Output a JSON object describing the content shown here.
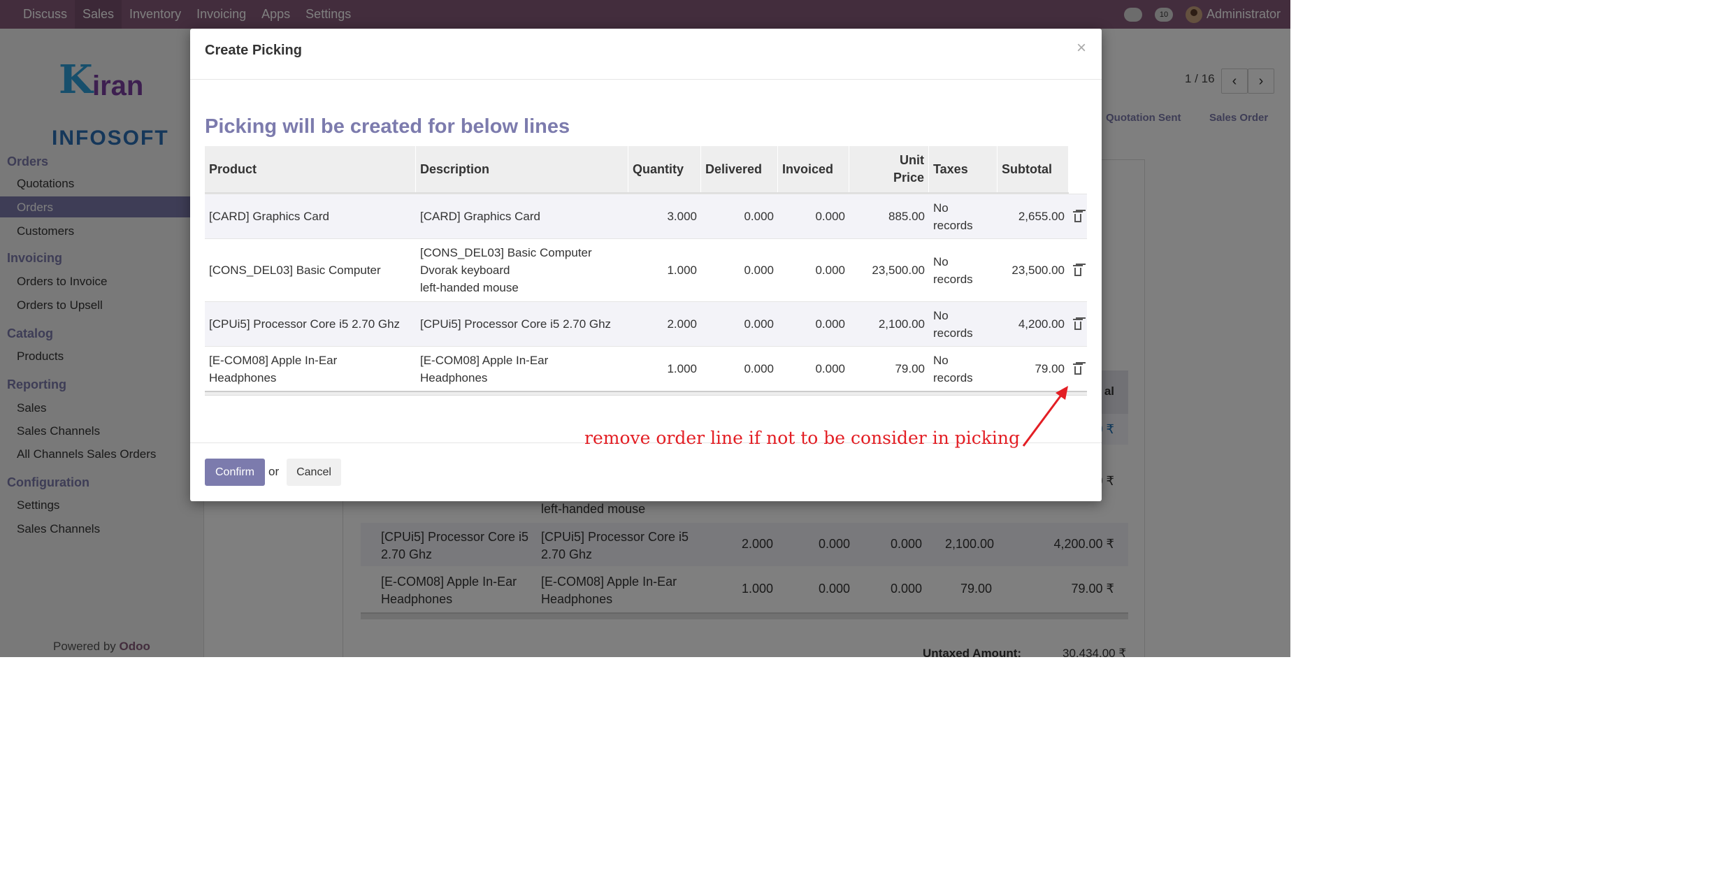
{
  "topbar": {
    "menu": [
      "Discuss",
      "Sales",
      "Inventory",
      "Invoicing",
      "Apps",
      "Settings"
    ],
    "active": "Sales",
    "user": "Administrator",
    "badge": "10"
  },
  "sidebar": {
    "logo_top": "Kiran",
    "logo_bottom": "INFOSOFT",
    "sections": [
      {
        "title": "Orders",
        "items": [
          "Quotations",
          "Orders",
          "Customers"
        ]
      },
      {
        "title": "Invoicing",
        "items": [
          "Orders to Invoice",
          "Orders to Upsell"
        ]
      },
      {
        "title": "Catalog",
        "items": [
          "Products"
        ]
      },
      {
        "title": "Reporting",
        "items": [
          "Sales",
          "Sales Channels",
          "All Channels Sales Orders"
        ]
      },
      {
        "title": "Configuration",
        "items": [
          "Settings",
          "Sales Channels"
        ]
      }
    ],
    "active_item": "Orders",
    "powered_by": "Powered by",
    "powered_brand": "Odoo"
  },
  "background": {
    "pager": "1 / 16",
    "stages": [
      "Quotation Sent",
      "Sales Order"
    ],
    "subtotal_col_partial": "al",
    "amount_partial_1": "00 ₹",
    "amount_partial_2": "00 ₹",
    "mouse_line": "left-handed mouse",
    "rows": [
      {
        "product": "[CPUi5] Processor Core i5\n2.70 Ghz",
        "description": "[CPUi5] Processor Core i5\n2.70 Ghz",
        "qty": "2.000",
        "delivered": "0.000",
        "invoiced": "0.000",
        "price": "2,100.00",
        "subtotal": "4,200.00 ₹"
      },
      {
        "product": "[E-COM08] Apple In-Ear\nHeadphones",
        "description": "[E-COM08] Apple In-Ear\nHeadphones",
        "qty": "1.000",
        "delivered": "0.000",
        "invoiced": "0.000",
        "price": "79.00",
        "subtotal": "79.00 ₹"
      }
    ],
    "untaxed_label": "Untaxed Amount:",
    "untaxed_value": "30,434.00 ₹"
  },
  "modal": {
    "title": "Create Picking",
    "close": "×",
    "heading": "Picking will be created for below lines",
    "columns": [
      "Product",
      "Description",
      "Quantity",
      "Delivered",
      "Invoiced",
      "Unit\nPrice",
      "Taxes",
      "Subtotal"
    ],
    "lines": [
      {
        "product": "[CARD] Graphics Card",
        "description": "[CARD] Graphics Card",
        "qty": "3.000",
        "delivered": "0.000",
        "invoiced": "0.000",
        "price": "885.00",
        "taxes": "No\nrecords",
        "subtotal": "2,655.00"
      },
      {
        "product": "[CONS_DEL03] Basic Computer",
        "description": "[CONS_DEL03] Basic Computer\nDvorak keyboard\nleft-handed mouse",
        "qty": "1.000",
        "delivered": "0.000",
        "invoiced": "0.000",
        "price": "23,500.00",
        "taxes": "No\nrecords",
        "subtotal": "23,500.00"
      },
      {
        "product": "[CPUi5] Processor Core i5 2.70 Ghz",
        "description": "[CPUi5] Processor Core i5 2.70 Ghz",
        "qty": "2.000",
        "delivered": "0.000",
        "invoiced": "0.000",
        "price": "2,100.00",
        "taxes": "No\nrecords",
        "subtotal": "4,200.00"
      },
      {
        "product": "[E-COM08] Apple In-Ear\nHeadphones",
        "description": "[E-COM08] Apple In-Ear\nHeadphones",
        "qty": "1.000",
        "delivered": "0.000",
        "invoiced": "0.000",
        "price": "79.00",
        "taxes": "No\nrecords",
        "subtotal": "79.00"
      }
    ],
    "confirm": "Confirm",
    "or": "or",
    "cancel": "Cancel"
  },
  "annotation": "remove order line if not to be consider in picking",
  "colors": {
    "brand": "#875a7b",
    "accent": "#7c7bad",
    "annotation": "#e31e24"
  }
}
